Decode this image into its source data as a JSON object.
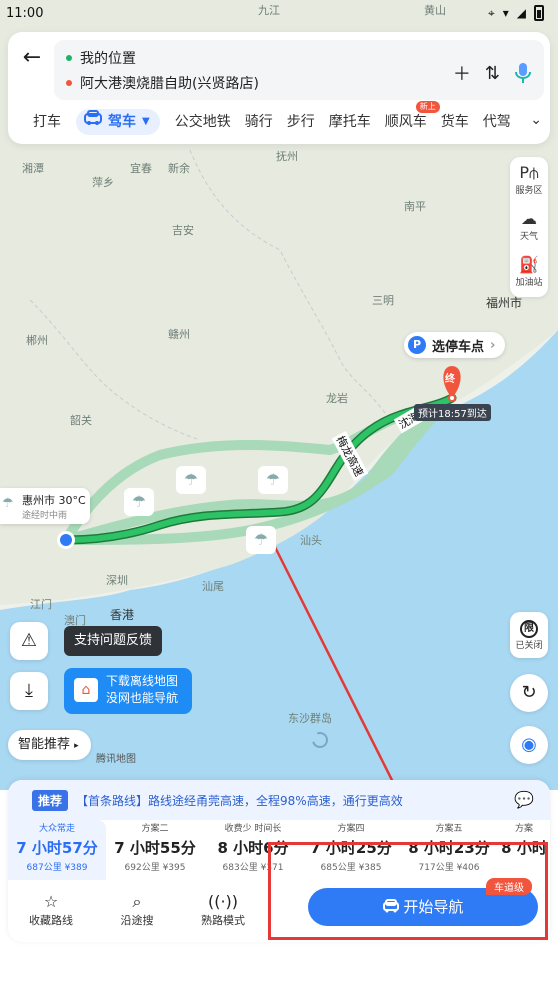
{
  "status_bar": {
    "time": "11:00"
  },
  "route": {
    "from": "我的位置",
    "to": "阿大港澳烧腊自助(兴贤路店)",
    "from_color": "#1bb368",
    "to_color": "#f2553d"
  },
  "tabs": [
    {
      "label": "打车"
    },
    {
      "label": "驾车",
      "active": true
    },
    {
      "label": "公交地铁"
    },
    {
      "label": "骑行"
    },
    {
      "label": "步行"
    },
    {
      "label": "摩托车"
    },
    {
      "label": "顺风车",
      "badge": "新上"
    },
    {
      "label": "货车"
    },
    {
      "label": "代驾"
    }
  ],
  "right_controls": [
    {
      "label": "服务区",
      "icon": "fuel-icon"
    },
    {
      "label": "天气",
      "icon": "cloud-icon"
    },
    {
      "label": "加油站",
      "icon": "gas-pump-icon"
    }
  ],
  "limit_control": {
    "label": "已关闭",
    "glyph": "限"
  },
  "map": {
    "cities": [
      "南平",
      "福州市",
      "三明",
      "龙岩",
      "赣州",
      "吉安",
      "宜春",
      "萍乡",
      "抚州",
      "郴州",
      "韶关",
      "汕头",
      "深圳",
      "香港",
      "澳门",
      "江门",
      "汕尾",
      "东沙群岛",
      "湘潭",
      "新余",
      "九江",
      "黄山"
    ],
    "select_parking": "选停车点",
    "parking_glyph": "P",
    "dest_marker": "终",
    "eta": "预计18:57到达",
    "highway_labels": [
      "梅龙高速",
      "沈海"
    ],
    "weather_card": {
      "city": "惠州市",
      "temp": "30°C",
      "desc": "途经时中雨"
    },
    "map_credit": "腾讯地图"
  },
  "left_controls": {
    "feedback_tip": "支持问题反馈",
    "download_tip_line1": "下载离线地图",
    "download_tip_line2": "没网也能导航",
    "smart_recommend": "智能推荐"
  },
  "bottom_sheet": {
    "recommend_tag": "推荐",
    "banner_text": "【首条路线】路线途经甬莞高速，全程98%高速，通行更高效",
    "plans": [
      {
        "label": "大众常走",
        "time": "7 小时57分",
        "dist": "687公里",
        "cost": "¥389",
        "active": true
      },
      {
        "label": "方案二",
        "time": "7 小时55分",
        "dist": "692公里",
        "cost": "¥395"
      },
      {
        "label": "收费少 时间长",
        "time": "8 小时6分",
        "dist": "683公里",
        "cost": "¥371"
      },
      {
        "label": "方案四",
        "time": "7 小时25分",
        "dist": "685公里",
        "cost": "¥385"
      },
      {
        "label": "方案五",
        "time": "8 小时23分",
        "dist": "717公里",
        "cost": "¥406"
      },
      {
        "label": "方案",
        "time": "8 小时",
        "dist": "",
        "cost": ""
      }
    ],
    "actions": [
      {
        "label": "收藏路线",
        "icon": "star-icon"
      },
      {
        "label": "沿途搜",
        "icon": "search-icon"
      },
      {
        "label": "熟路模式",
        "icon": "broadcast-icon"
      }
    ],
    "lane_badge": "车道级",
    "start_nav": "开始导航"
  }
}
